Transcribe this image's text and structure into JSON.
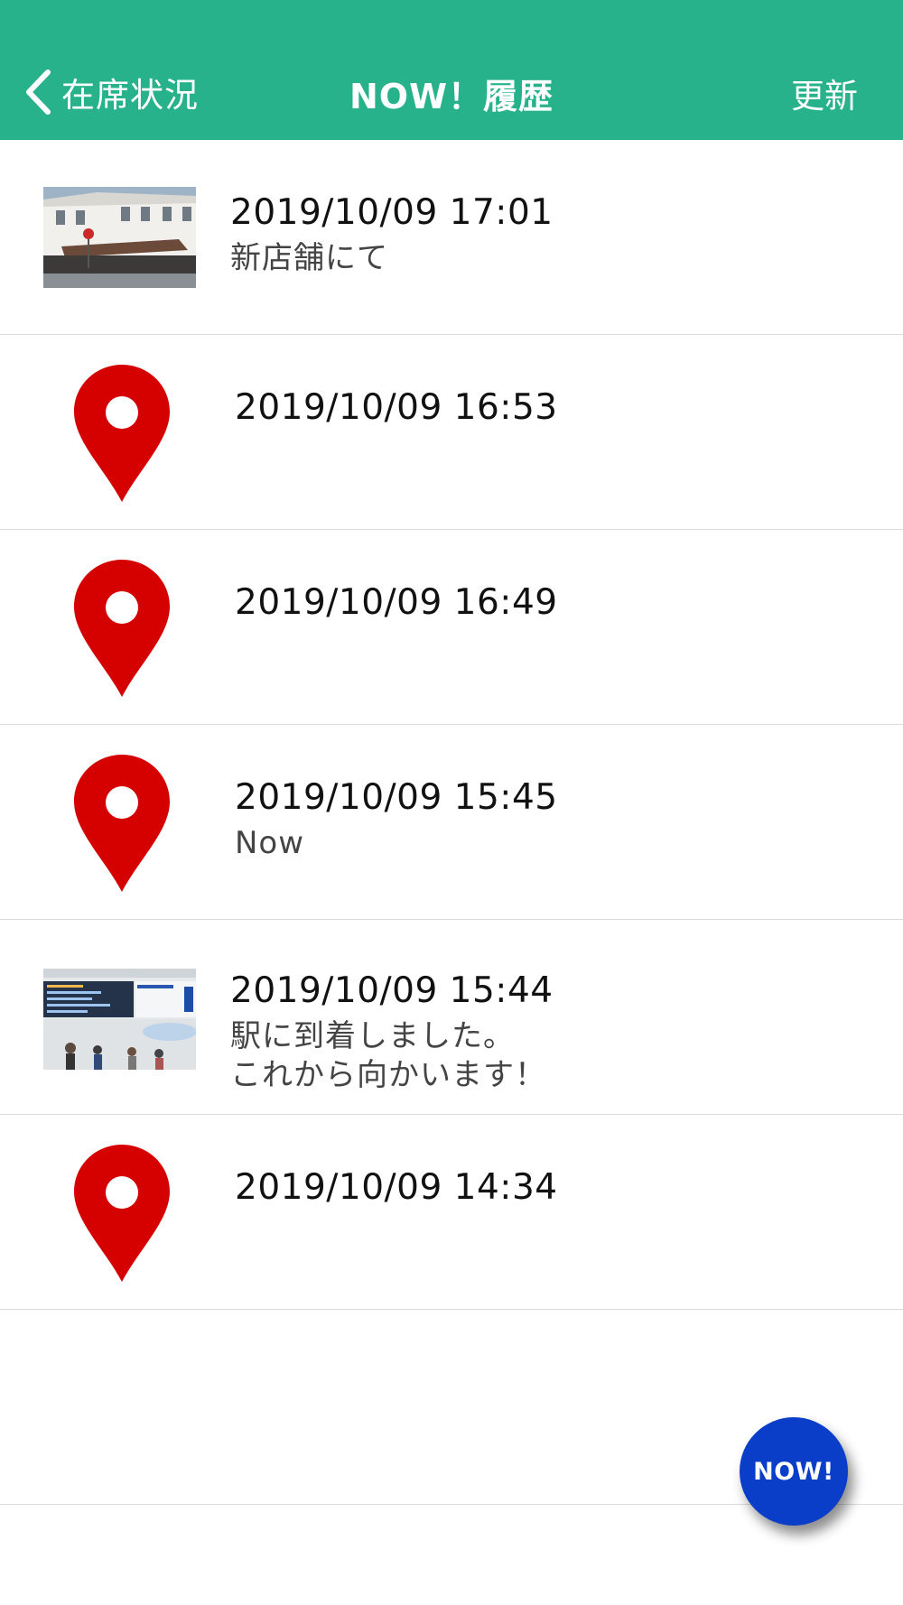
{
  "header": {
    "back_label": "在席状況",
    "title": "NOW！履歴",
    "refresh_label": "更新"
  },
  "colors": {
    "header_bg": "#27B28B",
    "pin": "#D50000",
    "fab": "#0A3EC8"
  },
  "entries": [
    {
      "type": "photo",
      "icon": "storefront-photo",
      "time": "2019/10/09 17:01",
      "note": "新店舗にて"
    },
    {
      "type": "location",
      "icon": "map-pin-icon",
      "time": "2019/10/09 16:53",
      "note": ""
    },
    {
      "type": "location",
      "icon": "map-pin-icon",
      "time": "2019/10/09 16:49",
      "note": ""
    },
    {
      "type": "location",
      "icon": "map-pin-icon",
      "time": "2019/10/09 15:45",
      "note": "Now"
    },
    {
      "type": "photo",
      "icon": "station-photo",
      "time": "2019/10/09 15:44",
      "note": "駅に到着しました。\nこれから向かいます！"
    },
    {
      "type": "location",
      "icon": "map-pin-icon",
      "time": "2019/10/09 14:34",
      "note": ""
    }
  ],
  "fab": {
    "label": "NOW!"
  }
}
